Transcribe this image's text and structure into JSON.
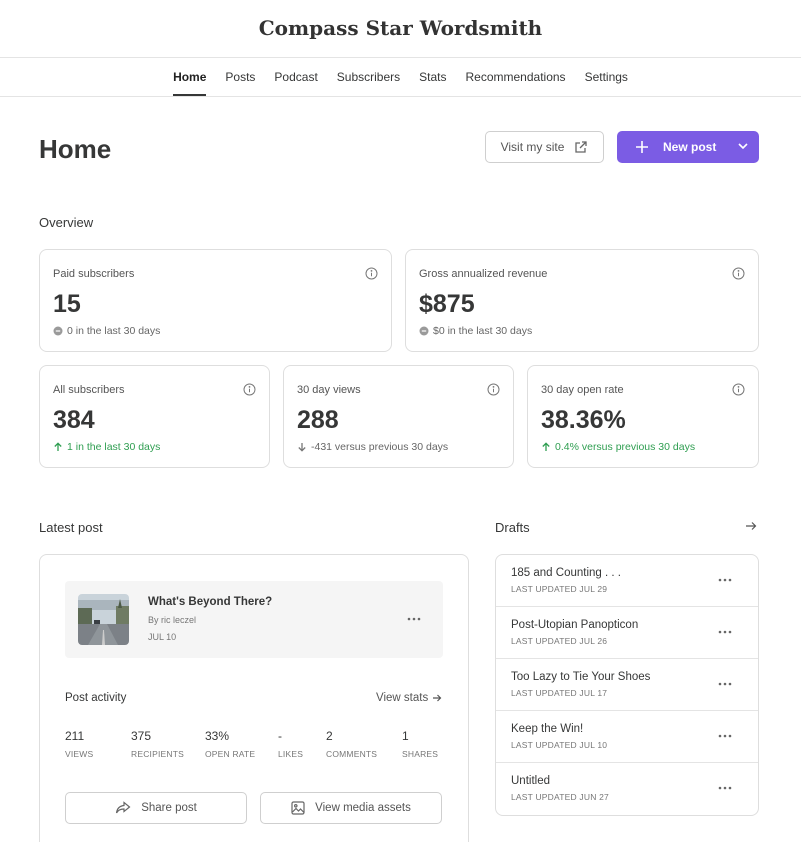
{
  "site": {
    "title": "Compass Star Wordsmith"
  },
  "nav": {
    "items": [
      {
        "label": "Home"
      },
      {
        "label": "Posts"
      },
      {
        "label": "Podcast"
      },
      {
        "label": "Subscribers"
      },
      {
        "label": "Stats"
      },
      {
        "label": "Recommendations"
      },
      {
        "label": "Settings"
      }
    ],
    "active_index": 0
  },
  "header": {
    "title": "Home",
    "visit_label": "Visit my site",
    "new_post_label": "New post"
  },
  "overview": {
    "label": "Overview",
    "paid": {
      "label": "Paid subscribers",
      "value": "15",
      "sub": "0 in the last 30 days"
    },
    "revenue": {
      "label": "Gross annualized revenue",
      "value": "$875",
      "sub": "$0 in the last 30 days"
    },
    "all_subs": {
      "label": "All subscribers",
      "value": "384",
      "sub": "1 in the last 30 days"
    },
    "views": {
      "label": "30 day views",
      "value": "288",
      "sub": "-431 versus previous 30 days"
    },
    "open_rate": {
      "label": "30 day open rate",
      "value": "38.36%",
      "sub": "0.4% versus previous 30 days"
    }
  },
  "latest": {
    "label": "Latest post",
    "post": {
      "title": "What's Beyond There?",
      "author": "By ric leczel",
      "date": "JUL 10"
    },
    "activity_label": "Post activity",
    "view_stats_label": "View stats",
    "metrics": [
      {
        "value": "211",
        "label": "VIEWS"
      },
      {
        "value": "375",
        "label": "RECIPIENTS"
      },
      {
        "value": "33%",
        "label": "OPEN RATE"
      },
      {
        "value": "-",
        "label": "LIKES"
      },
      {
        "value": "2",
        "label": "COMMENTS"
      },
      {
        "value": "1",
        "label": "SHARES"
      }
    ],
    "share_label": "Share post",
    "media_label": "View media assets"
  },
  "drafts": {
    "label": "Drafts",
    "items": [
      {
        "title": "185 and Counting . . .",
        "date": "LAST UPDATED JUL 29"
      },
      {
        "title": "Post-Utopian Panopticon",
        "date": "LAST UPDATED JUL 26"
      },
      {
        "title": "Too Lazy to Tie Your Shoes",
        "date": "LAST UPDATED JUL 17"
      },
      {
        "title": "Keep the Win!",
        "date": "LAST UPDATED JUL 10"
      },
      {
        "title": "Untitled",
        "date": "LAST UPDATED JUN 27"
      }
    ]
  },
  "colors": {
    "accent": "#7b5ce4",
    "positive": "#2f9e51",
    "text": "#363737",
    "border": "#dedede"
  }
}
